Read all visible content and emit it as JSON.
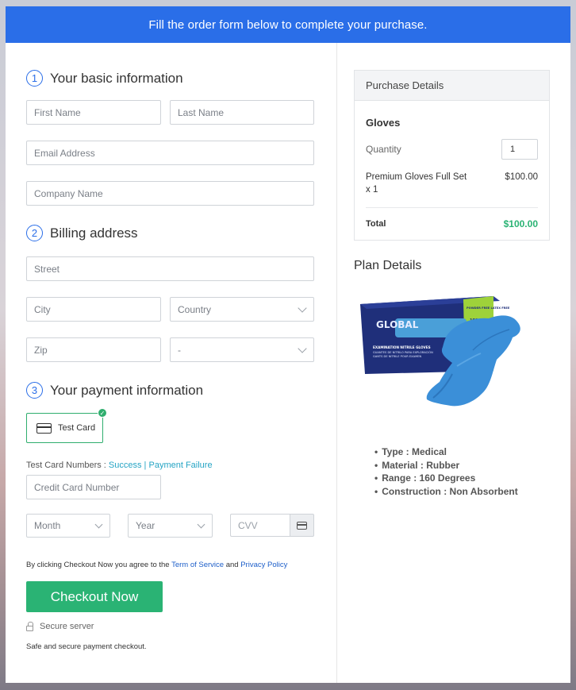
{
  "banner": "Fill the order form below to complete your purchase.",
  "sections": {
    "basic": {
      "num": "1",
      "title": "Your basic information"
    },
    "billing": {
      "num": "2",
      "title": "Billing address"
    },
    "payment": {
      "num": "3",
      "title": "Your payment information"
    }
  },
  "fields": {
    "first_name": "First Name",
    "last_name": "Last Name",
    "email": "Email Address",
    "company": "Company Name",
    "street": "Street",
    "city": "City",
    "country": "Country",
    "zip": "Zip",
    "state": "-",
    "card_number": "Credit Card Number",
    "month": "Month",
    "year": "Year",
    "cvv": "CVV"
  },
  "payment": {
    "card_label": "Test Card",
    "test_numbers_label": "Test Card Numbers : ",
    "success_link": "Success",
    "separator": " | ",
    "failure_link": "Payment Failure"
  },
  "terms": {
    "prefix": "By clicking Checkout Now you agree to the ",
    "terms_link": "Term of Service",
    "and": " and ",
    "privacy_link": "Privacy Policy"
  },
  "checkout_label": "Checkout Now",
  "secure_label": "Secure server",
  "safe_label": "Safe and secure payment checkout.",
  "purchase": {
    "header": "Purchase Details",
    "product": "Gloves",
    "quantity_label": "Quantity",
    "quantity_value": "1",
    "line_item": "Premium Gloves Full Set",
    "line_qty": "x 1",
    "line_price": "$100.00",
    "total_label": "Total",
    "total_value": "$100.00"
  },
  "plan": {
    "title": "Plan Details",
    "box_text": {
      "brand": "GLOBAL",
      "line1": "EXAMINATION NITRILE GLOVES",
      "line2": "GUANTES DE NITRILO PARA EXPLORACIÓN",
      "line3": "GANTS DE NITRILE POUR EXAMEN",
      "badge": "POWDER FREE LATEX FREE",
      "pcs": "100 PCS"
    },
    "features": [
      "Type : Medical",
      "Material : Rubber",
      "Range : 160 Degrees",
      "Construction : Non Absorbent"
    ]
  },
  "colors": {
    "accent": "#2a6ee8",
    "success": "#2ab374",
    "link": "#25a4c4"
  }
}
